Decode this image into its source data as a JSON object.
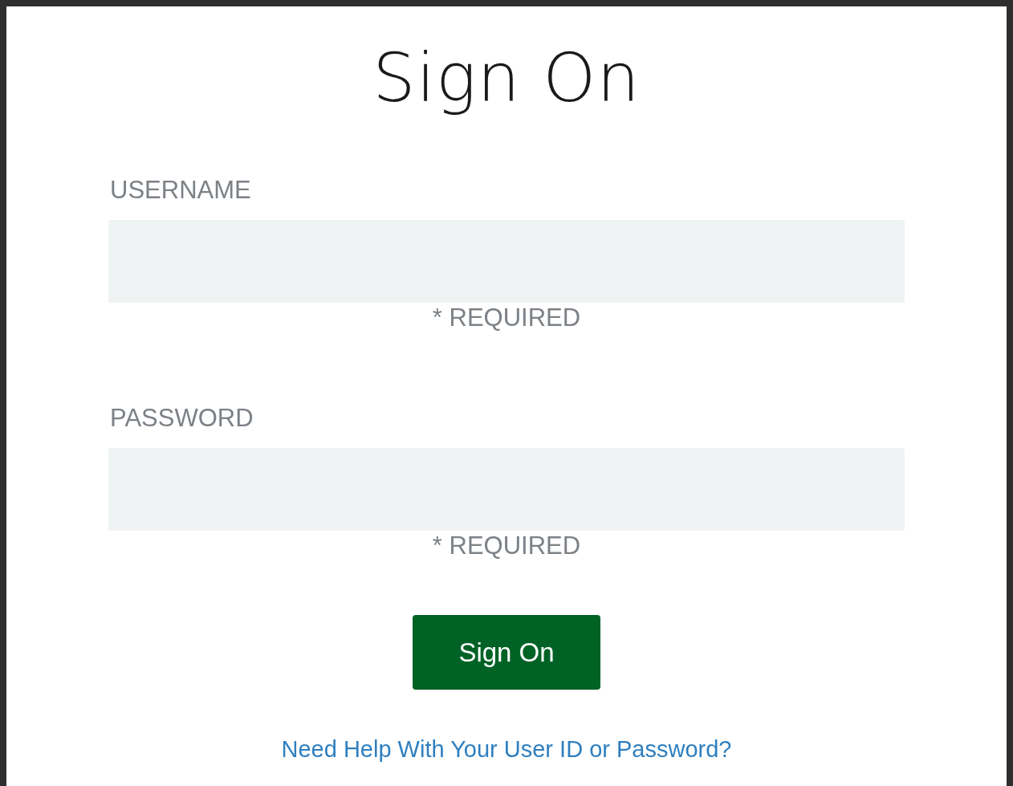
{
  "title": "Sign On",
  "fields": [
    {
      "label": "USERNAME",
      "required": "* REQUIRED"
    },
    {
      "label": "PASSWORD",
      "required": "* REQUIRED"
    }
  ],
  "button": "Sign On",
  "help_link": "Need Help With Your User ID or Password?"
}
